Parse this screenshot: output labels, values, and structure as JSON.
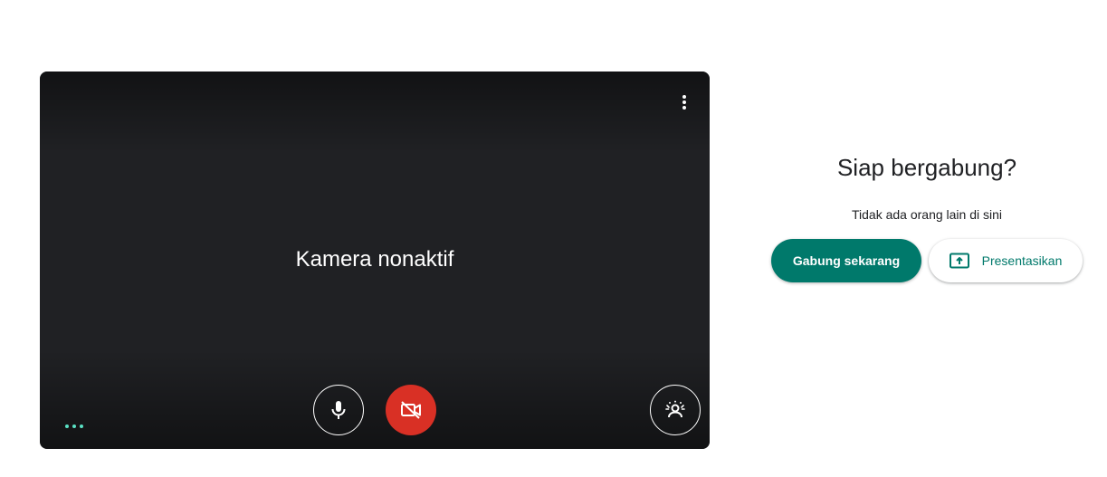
{
  "preview": {
    "camera_status": "Kamera nonaktif",
    "icons": {
      "more_options": "more-vert-icon",
      "microphone": "mic-icon",
      "camera": "videocam-off-icon",
      "effects": "visual-effects-icon",
      "audio_indicator": "audio-level-dots-icon"
    }
  },
  "join_panel": {
    "title": "Siap bergabung?",
    "status": "Tidak ada orang lain di sini",
    "join_label": "Gabung sekarang",
    "present_label": "Presentasikan",
    "present_icon": "present-to-all-icon"
  },
  "colors": {
    "preview_bg": "#202124",
    "camera_off_red": "#d93025",
    "primary_green": "#00796b",
    "audio_dot": "#5ae1c4"
  }
}
